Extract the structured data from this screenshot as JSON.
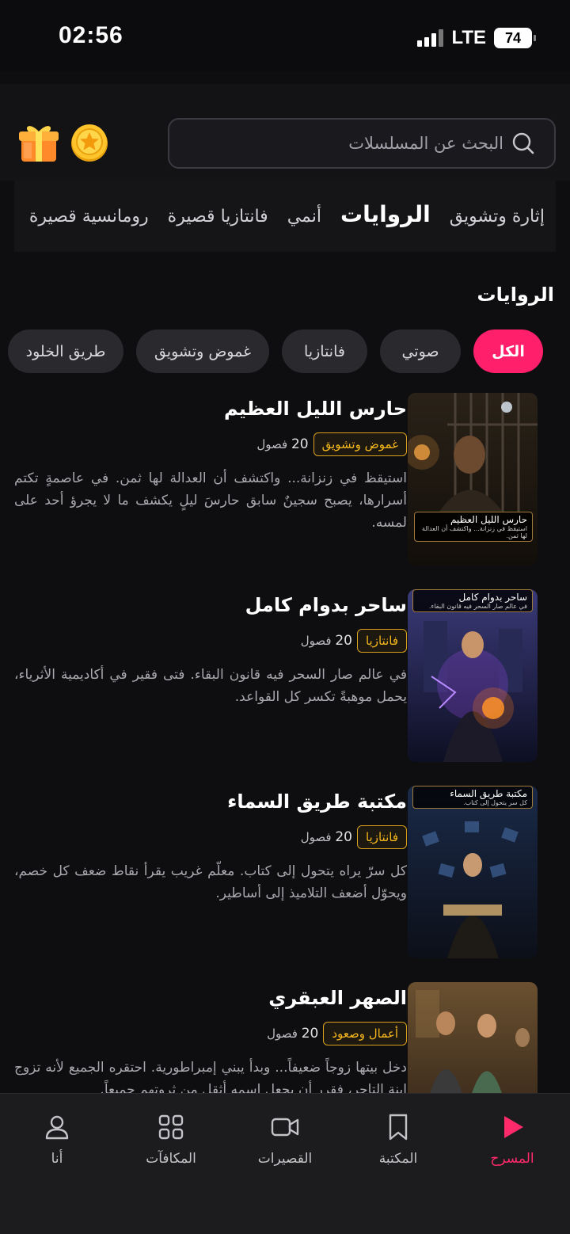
{
  "status": {
    "time": "02:56",
    "network": "LTE",
    "battery": "74"
  },
  "search": {
    "placeholder": "البحث عن المسلسلات"
  },
  "tabs": [
    "إثارة وتشويق",
    "الروايات",
    "أنمي",
    "فانتازيا قصيرة",
    "رومانسية قصيرة"
  ],
  "active_tab": "الروايات",
  "section_title": "الروايات",
  "chips": [
    "الكل",
    "صوتي",
    "فانتازيا",
    "غموض وتشويق",
    "طريق الخلود"
  ],
  "books": [
    {
      "title": "حارس الليل العظيم",
      "genre": "غموض وتشويق",
      "chapters_count": "20",
      "chapters_unit": "فصول",
      "description": "استيقظ في زنزانة... واكتشف أن العدالة لها ثمن. في عاصمةٍ تكتم أسرارها، يصبح سجينٌ سابق حارسَ ليلٍ يكشف ما لا يجرؤ أحد على لمسه.",
      "cover_title": "حارس الليل العظيم",
      "cover_subtitle": "استيقظ في زنزانة... واكتشف أن العدالة لها ثمن."
    },
    {
      "title": "ساحر بدوام كامل",
      "genre": "فانتازيا",
      "chapters_count": "20",
      "chapters_unit": "فصول",
      "description": "في عالم صار السحر فيه قانون البقاء. فتى فقير في أكاديمية الأثرياء، يحمل موهبةً تكسر كل القواعد.",
      "cover_title": "ساحر بدوام كامل",
      "cover_subtitle": "في عالم صار السحر فيه قانون البقاء."
    },
    {
      "title": "مكتبة طريق السماء",
      "genre": "فانتازيا",
      "chapters_count": "20",
      "chapters_unit": "فصول",
      "description": "كل سرّ يراه يتحول إلى كتاب. معلّم غريب يقرأ نقاط ضعف كل خصم، ويحوّل أضعف التلاميذ إلى أساطير.",
      "cover_title": "مكتبة طريق السماء",
      "cover_subtitle": "كل سر يتحول إلى كتاب."
    },
    {
      "title": "الصهر العبقري",
      "genre": "أعمال وصعود",
      "chapters_count": "20",
      "chapters_unit": "فصول",
      "description": "دخل بيتها زوجاً ضعيفاً... وبدأ يبني إمبراطورية. احتقره الجميع لأنه تزوج ابنة التاجر، فقرر أن يجعل اسمه أثقل من ثروتهم جميعاً.",
      "cover_title": "",
      "cover_subtitle": ""
    }
  ],
  "nav": [
    {
      "label": "المسرح",
      "icon": "play-icon",
      "active": true
    },
    {
      "label": "المكتبة",
      "icon": "bookmark-icon",
      "active": false
    },
    {
      "label": "القصيرات",
      "icon": "video-camera-icon",
      "active": false
    },
    {
      "label": "المكافآت",
      "icon": "grid-icon",
      "active": false
    },
    {
      "label": "أنا",
      "icon": "user-icon",
      "active": false
    }
  ],
  "colors": {
    "accent": "#ff1f6a",
    "badge": "#f5b81d",
    "background": "#0e0e10"
  }
}
